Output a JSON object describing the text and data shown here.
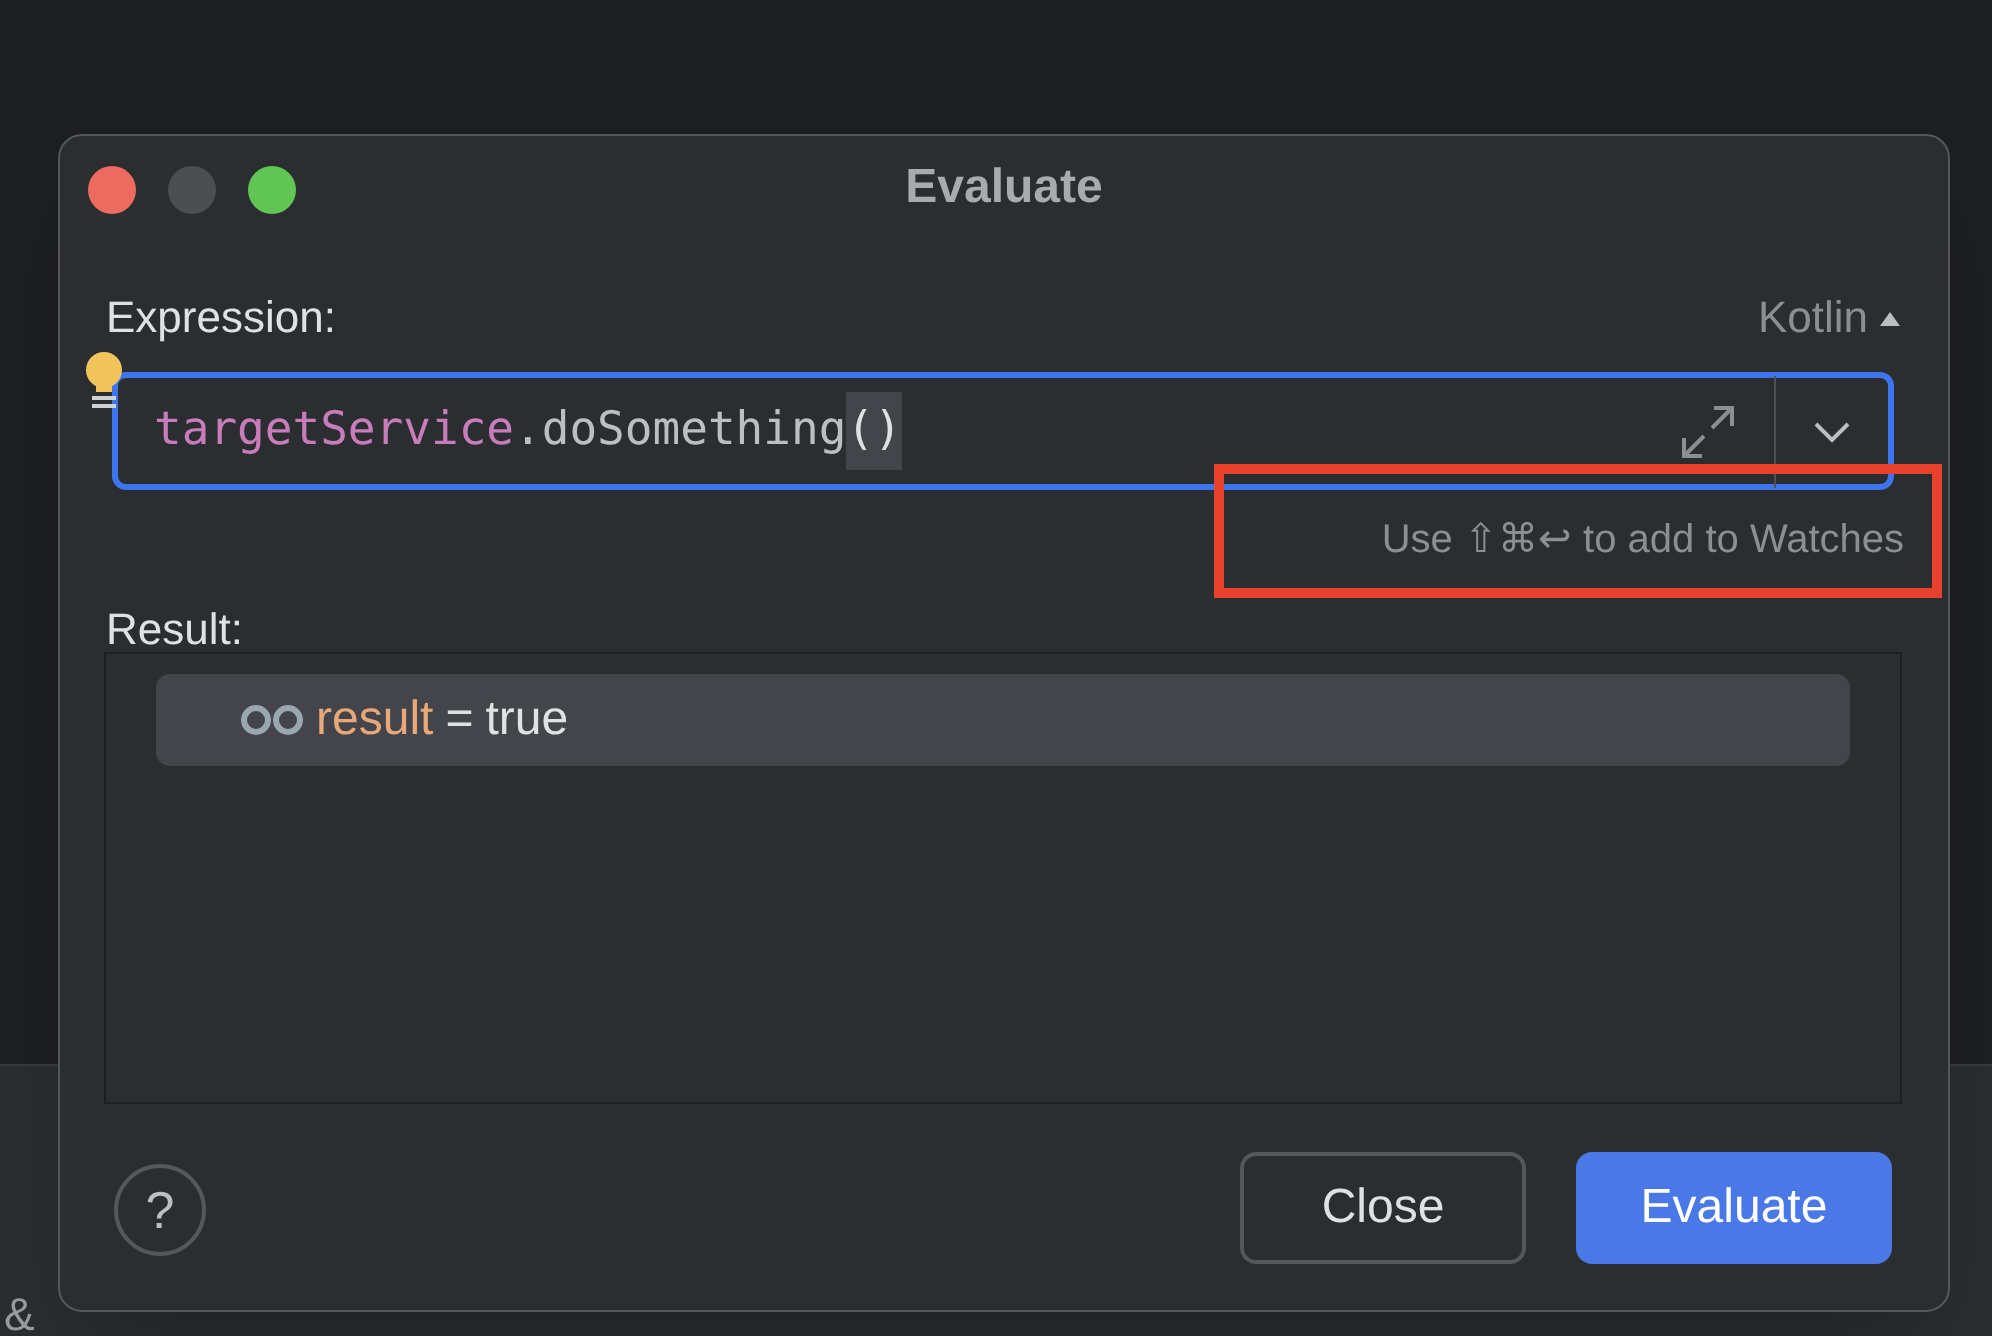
{
  "background_tabs": [
    {
      "label": "&"
    }
  ],
  "window": {
    "title": "Evaluate",
    "traffic_lights": [
      {
        "color": "#ec6a5e"
      },
      {
        "color": "#4d4e51"
      },
      {
        "color": "#61c554"
      }
    ]
  },
  "expression": {
    "label": "Expression:",
    "language": "Kotlin",
    "tokens": [
      {
        "text": "targetService",
        "kind": "property"
      },
      {
        "text": ".doSomething",
        "kind": "plain"
      },
      {
        "text": "()",
        "kind": "brace-match"
      }
    ],
    "hint": "Use ⇧⌘↩ to add to Watches",
    "highlighted": true
  },
  "result": {
    "label": "Result:",
    "rows": [
      {
        "name": "result",
        "operator": "=",
        "value": "true",
        "selected": true
      }
    ]
  },
  "buttons": [
    {
      "label": "?",
      "kind": "help"
    },
    {
      "label": "Close",
      "kind": "secondary"
    },
    {
      "label": "Evaluate",
      "kind": "primary"
    }
  ]
}
